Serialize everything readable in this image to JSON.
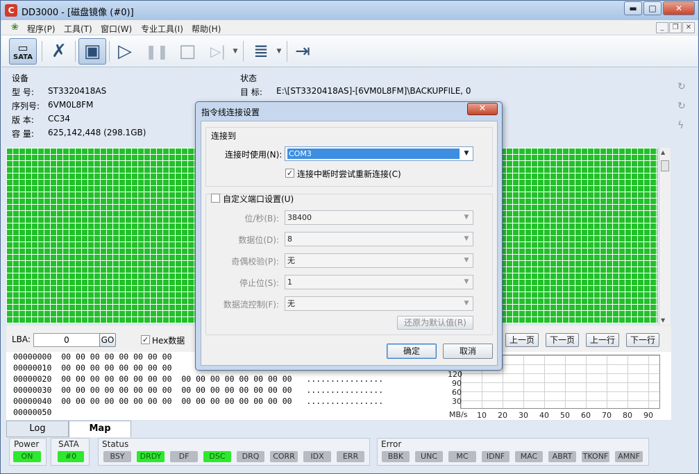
{
  "window": {
    "title": "DD3000 - [磁盘镜像 (#0)]",
    "icon_letter": "C",
    "min": "▬",
    "max": "□",
    "close": "✕"
  },
  "menu": [
    "程序(P)",
    "工具(T)",
    "窗口(W)",
    "专业工具(I)",
    "帮助(H)"
  ],
  "toolbar": {
    "sata_label": "SATA"
  },
  "device": {
    "header": "设备",
    "rows": [
      {
        "k": "型  号:",
        "v": "ST3320418AS"
      },
      {
        "k": "序列号:",
        "v": "6VM0L8FM"
      },
      {
        "k": "版  本:",
        "v": "CC34"
      },
      {
        "k": "容  量:",
        "v": "625,142,448 (298.1GB)"
      }
    ]
  },
  "status": {
    "header": "状态",
    "target_label": "目  标:",
    "target_value": "E:\\[ST3320418AS]-[6VM0L8FM]\\BACKUPFILE, 0"
  },
  "hexbar": {
    "lba_label": "LBA:",
    "lba_value": "0",
    "go": "GO",
    "hex_label": "Hex数据",
    "prev_page": "上一页",
    "next_page": "下一页",
    "prev_line": "上一行",
    "next_line": "下一行"
  },
  "hex_rows": [
    {
      "addr": "00000000",
      "bytes": "00 00 00 00 00 00 00 00"
    },
    {
      "addr": "00000010",
      "bytes": "00 00 00 00 00 00 00 00"
    },
    {
      "addr": "00000020",
      "bytes": "00 00 00 00 00 00 00 00  00 00 00 00 00 00 00 00   ................"
    },
    {
      "addr": "00000030",
      "bytes": "00 00 00 00 00 00 00 00  00 00 00 00 00 00 00 00   ................"
    },
    {
      "addr": "00000040",
      "bytes": "00 00 00 00 00 00 00 00  00 00 00 00 00 00 00 00   ................"
    },
    {
      "addr": "00000050",
      "bytes": ""
    }
  ],
  "speed_chart": {
    "y_ticks": [
      "120",
      "90",
      "60",
      "30"
    ],
    "y_unit": "MB/s",
    "x_ticks": [
      "10",
      "20",
      "30",
      "40",
      "50",
      "60",
      "70",
      "80",
      "90"
    ]
  },
  "tabs": [
    "Log",
    "Map"
  ],
  "statusbar": {
    "power_label": "Power",
    "power_value": "ON",
    "sata_label": "SATA",
    "sata_value": "#0",
    "status_label": "Status",
    "status_flags": [
      {
        "name": "BSY",
        "active": false
      },
      {
        "name": "DRDY",
        "active": true
      },
      {
        "name": "DF",
        "active": false
      },
      {
        "name": "DSC",
        "active": true
      },
      {
        "name": "DRQ",
        "active": false
      },
      {
        "name": "CORR",
        "active": false
      },
      {
        "name": "IDX",
        "active": false
      },
      {
        "name": "ERR",
        "active": false
      }
    ],
    "error_label": "Error",
    "error_flags": [
      "BBK",
      "UNC",
      "MC",
      "IDNF",
      "MAC",
      "ABRT",
      "TKONF",
      "AMNF"
    ]
  },
  "dialog": {
    "title": "指令线连接设置",
    "group_connect": "连接到",
    "use_label": "连接时使用(N):",
    "use_value": "COM3",
    "reconnect_label": "连接中断时尝试重新连接(C)",
    "custom_label": "自定义端口设置(U)",
    "fields": [
      {
        "label": "位/秒(B):",
        "value": "38400"
      },
      {
        "label": "数据位(D):",
        "value": "8"
      },
      {
        "label": "奇偶校验(P):",
        "value": "无"
      },
      {
        "label": "停止位(S):",
        "value": "1"
      },
      {
        "label": "数据流控制(F):",
        "value": "无"
      }
    ],
    "restore": "还原为默认值(R)",
    "ok": "确定",
    "cancel": "取消"
  }
}
